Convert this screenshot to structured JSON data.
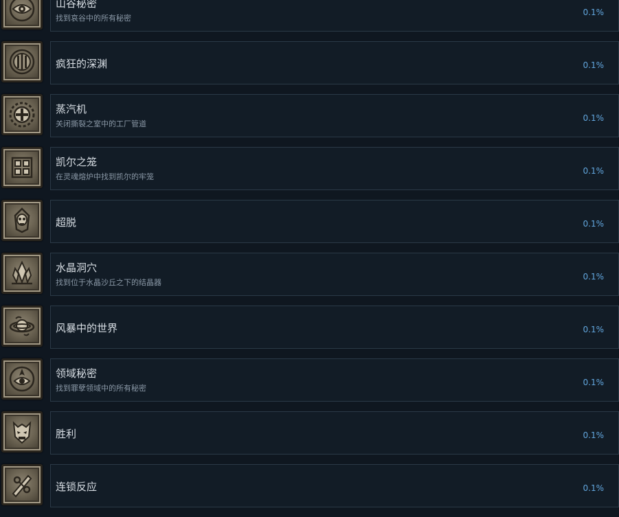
{
  "achievements": [
    {
      "name": "山谷秘密",
      "desc": "找到哀谷中的所有秘密",
      "percent": "0.1%",
      "icon": "eye-emblem-icon"
    },
    {
      "name": "疯狂的深渊",
      "desc": "",
      "percent": "0.1%",
      "icon": "sealed-gate-icon"
    },
    {
      "name": "蒸汽机",
      "desc": "关闭撕裂之室中的工厂管道",
      "percent": "0.1%",
      "icon": "valve-wheel-icon"
    },
    {
      "name": "凯尔之笼",
      "desc": "在灵魂熔炉中找到凯尔的牢笼",
      "percent": "0.1%",
      "icon": "cage-grid-icon"
    },
    {
      "name": "超脱",
      "desc": "",
      "percent": "0.1%",
      "icon": "skull-flame-icon"
    },
    {
      "name": "水晶洞穴",
      "desc": "找到位于水晶沙丘之下的结晶器",
      "percent": "0.1%",
      "icon": "crystal-icon"
    },
    {
      "name": "风暴中的世界",
      "desc": "",
      "percent": "0.1%",
      "icon": "storm-world-icon"
    },
    {
      "name": "领域秘密",
      "desc": "找到罪孽领域中的所有秘密",
      "percent": "0.1%",
      "icon": "realm-eye-icon"
    },
    {
      "name": "胜利",
      "desc": "",
      "percent": "0.1%",
      "icon": "demon-mask-icon"
    },
    {
      "name": "连锁反应",
      "desc": "",
      "percent": "0.1%",
      "icon": "chain-blade-icon"
    }
  ]
}
